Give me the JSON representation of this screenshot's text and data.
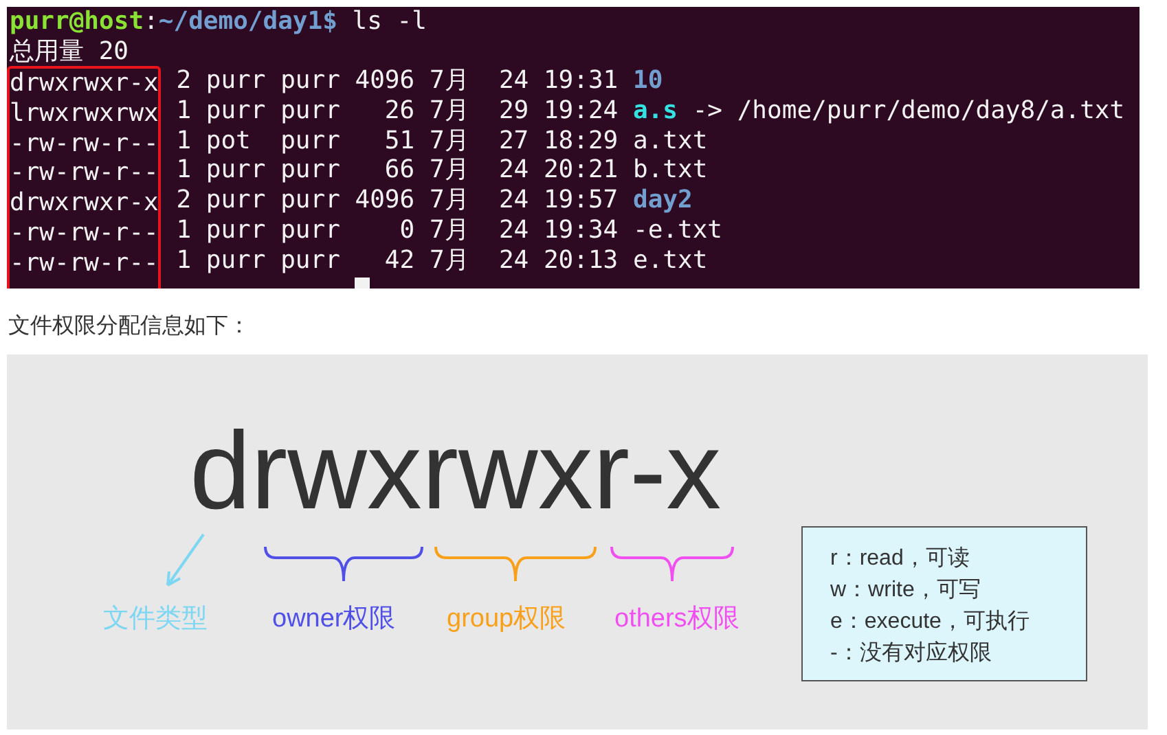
{
  "terminal": {
    "prompt": {
      "user_host": "purr@host",
      "separator": ":",
      "path": "~/demo/day1",
      "symbol": "$",
      "command": "ls -l"
    },
    "total": "总用量 20",
    "highlight_permissions": true,
    "rows": [
      {
        "permissions": "drwxrwxr-x",
        "details": "2 purr purr 4096 7月  24 19:31",
        "name": "10",
        "kind": "directory"
      },
      {
        "permissions": "lrwxrwxrwx",
        "details": "1 purr purr   26 7月  29 19:24",
        "name": "a.s",
        "kind": "symlink",
        "target": "-> /home/purr/demo/day8/a.txt"
      },
      {
        "permissions": "-rw-rw-r--",
        "details": "1 pot  purr   51 7月  27 18:29",
        "name": "a.txt",
        "kind": "file"
      },
      {
        "permissions": "-rw-rw-r--",
        "details": "1 purr purr   66 7月  24 20:21",
        "name": "b.txt",
        "kind": "file"
      },
      {
        "permissions": "drwxrwxr-x",
        "details": "2 purr purr 4096 7月  24 19:57",
        "name": "day2",
        "kind": "directory"
      },
      {
        "permissions": "-rw-rw-r--",
        "details": "1 purr purr    0 7月  24 19:34",
        "name": "-e.txt",
        "kind": "file"
      },
      {
        "permissions": "-rw-rw-r--",
        "details": "1 purr purr   42 7月  24 20:13",
        "name": "e.txt",
        "kind": "file"
      }
    ]
  },
  "caption": "文件权限分配信息如下：",
  "diagram": {
    "permission_string": "drwxrwxr-x",
    "labels": [
      {
        "text": "文件类型",
        "color": "#7dd6f2",
        "kind": "arrow"
      },
      {
        "text": "owner权限",
        "color": "#5050e6",
        "kind": "brace"
      },
      {
        "text": "group权限",
        "color": "#f9a01b",
        "kind": "brace"
      },
      {
        "text": "others权限",
        "color": "#f050f0",
        "kind": "brace"
      }
    ],
    "legend": [
      "r：read，可读",
      "w：write，可写",
      "e：execute，可执行",
      "-：没有对应权限"
    ]
  }
}
